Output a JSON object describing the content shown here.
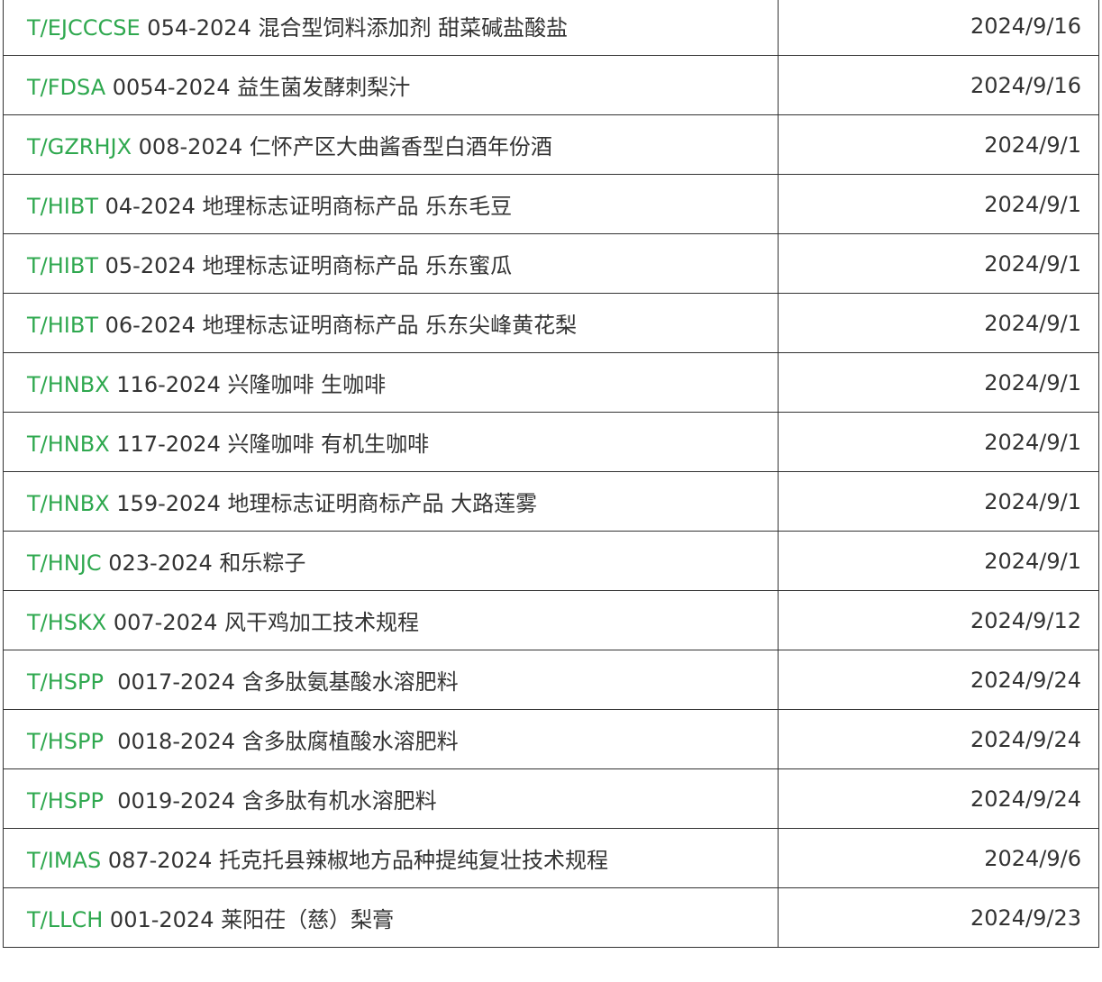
{
  "rows": [
    {
      "code": "T/EJCCCSE",
      "rest": " 054-2024 混合型饲料添加剂 甜菜碱盐酸盐",
      "date": "2024/9/16"
    },
    {
      "code": "T/FDSA",
      "rest": " 0054-2024 益生菌发酵刺梨汁",
      "date": "2024/9/16"
    },
    {
      "code": "T/GZRHJX",
      "rest": " 008-2024 仁怀产区大曲酱香型白酒年份酒",
      "date": "2024/9/1"
    },
    {
      "code": "T/HIBT",
      "rest": " 04-2024 地理标志证明商标产品 乐东毛豆",
      "date": "2024/9/1"
    },
    {
      "code": "T/HIBT",
      "rest": " 05-2024 地理标志证明商标产品 乐东蜜瓜",
      "date": "2024/9/1"
    },
    {
      "code": "T/HIBT",
      "rest": " 06-2024 地理标志证明商标产品 乐东尖峰黄花梨",
      "date": "2024/9/1"
    },
    {
      "code": "T/HNBX",
      "rest": " 116-2024 兴隆咖啡 生咖啡",
      "date": "2024/9/1"
    },
    {
      "code": "T/HNBX",
      "rest": " 117-2024 兴隆咖啡 有机生咖啡",
      "date": "2024/9/1"
    },
    {
      "code": "T/HNBX",
      "rest": " 159-2024 地理标志证明商标产品 大路莲雾",
      "date": "2024/9/1"
    },
    {
      "code": "T/HNJC",
      "rest": " 023-2024 和乐粽子",
      "date": "2024/9/1"
    },
    {
      "code": "T/HSKX",
      "rest": " 007-2024 风干鸡加工技术规程",
      "date": "2024/9/12"
    },
    {
      "code": "T/HSPP",
      "rest": "  0017-2024 含多肽氨基酸水溶肥料",
      "date": "2024/9/24"
    },
    {
      "code": "T/HSPP",
      "rest": "  0018-2024 含多肽腐植酸水溶肥料",
      "date": "2024/9/24"
    },
    {
      "code": "T/HSPP",
      "rest": "  0019-2024 含多肽有机水溶肥料",
      "date": "2024/9/24"
    },
    {
      "code": "T/IMAS",
      "rest": " 087-2024 托克托县辣椒地方品种提纯复壮技术规程",
      "date": "2024/9/6"
    },
    {
      "code": "T/LLCH",
      "rest": " 001-2024 莱阳茌（慈）梨膏",
      "date": "2024/9/23"
    }
  ],
  "colors": {
    "code_link": "#2fa84f",
    "text": "#333333",
    "border": "#333333"
  }
}
